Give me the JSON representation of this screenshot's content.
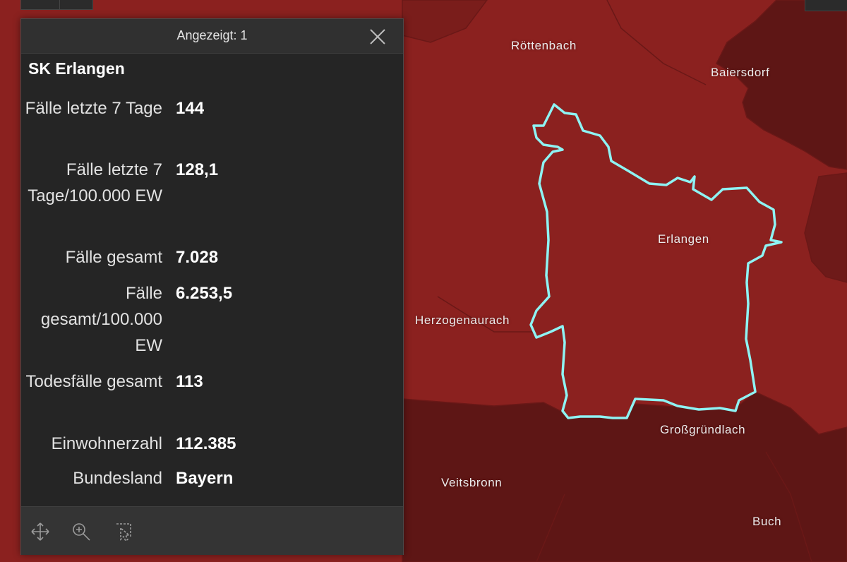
{
  "map": {
    "colors": {
      "region_default": "#8b211f",
      "region_dark": "#5e1615",
      "highlight_outline": "#8ef3f3",
      "boundary": "#6a1817"
    },
    "places": [
      {
        "id": "roettenbach",
        "name": "Röttenbach"
      },
      {
        "id": "baiersdorf",
        "name": "Baiersdorf"
      },
      {
        "id": "erlangen",
        "name": "Erlangen"
      },
      {
        "id": "herzogenaurach",
        "name": "Herzogenaurach"
      },
      {
        "id": "grossgruendlach",
        "name": "Großgründlach"
      },
      {
        "id": "veitsbronn",
        "name": "Veitsbronn"
      },
      {
        "id": "buch",
        "name": "Buch"
      }
    ]
  },
  "popup": {
    "header": "Angezeigt: 1",
    "title": "SK Erlangen",
    "attributes": [
      {
        "label": "Fälle letzte 7 Tage",
        "value": "144"
      },
      {
        "label": "Fälle letzte 7 Tage/100.000 EW",
        "value": "128,1"
      },
      {
        "label": "Fälle gesamt",
        "value": "7.028"
      },
      {
        "label": "Fälle gesamt/100.000 EW",
        "value": "6.253,5"
      },
      {
        "label": "Todesfälle gesamt",
        "value": "113"
      },
      {
        "label": "Einwohnerzahl",
        "value": "112.385"
      },
      {
        "label": "Bundesland",
        "value": "Bayern"
      }
    ],
    "footer_tools": [
      {
        "id": "pan",
        "icon": "move-arrows-icon"
      },
      {
        "id": "zoom",
        "icon": "zoom-in-icon"
      },
      {
        "id": "select",
        "icon": "select-cursor-icon"
      }
    ]
  }
}
